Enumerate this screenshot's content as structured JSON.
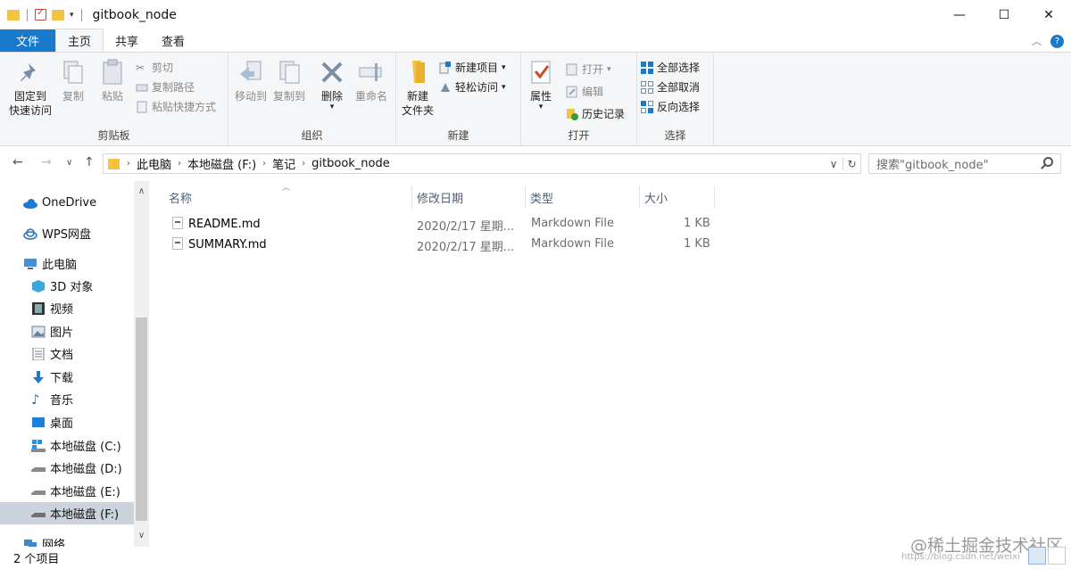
{
  "window": {
    "title": "gitbook_node"
  },
  "tabs": [
    {
      "label": "文件"
    },
    {
      "label": "主页"
    },
    {
      "label": "共享"
    },
    {
      "label": "查看"
    }
  ],
  "ribbon": {
    "clipboard": {
      "group_label": "剪贴板",
      "pin": "固定到",
      "pin2": "快速访问",
      "copy": "复制",
      "paste": "粘贴",
      "cut": "剪切",
      "copy_path": "复制路径",
      "paste_shortcut": "粘贴快捷方式"
    },
    "organize": {
      "group_label": "组织",
      "move_to": "移动到",
      "copy_to": "复制到",
      "delete": "删除",
      "rename": "重命名"
    },
    "new": {
      "group_label": "新建",
      "new_folder": "新建",
      "new_folder2": "文件夹",
      "new_item": "新建项目",
      "easy_access": "轻松访问"
    },
    "open": {
      "group_label": "打开",
      "properties": "属性",
      "open": "打开",
      "edit": "编辑",
      "history": "历史记录"
    },
    "select": {
      "group_label": "选择",
      "select_all": "全部选择",
      "select_none": "全部取消",
      "invert": "反向选择"
    }
  },
  "address": {
    "crumbs": [
      "此电脑",
      "本地磁盘 (F:)",
      "笔记",
      "gitbook_node"
    ]
  },
  "search": {
    "placeholder": "搜索\"gitbook_node\""
  },
  "nav": [
    {
      "label": "OneDrive"
    },
    {
      "label": "WPS网盘"
    },
    {
      "label": "此电脑"
    },
    {
      "label": "3D 对象"
    },
    {
      "label": "视频"
    },
    {
      "label": "图片"
    },
    {
      "label": "文档"
    },
    {
      "label": "下载"
    },
    {
      "label": "音乐"
    },
    {
      "label": "桌面"
    },
    {
      "label": "本地磁盘 (C:)"
    },
    {
      "label": "本地磁盘 (D:)"
    },
    {
      "label": "本地磁盘 (E:)"
    },
    {
      "label": "本地磁盘 (F:)"
    },
    {
      "label": "网络"
    }
  ],
  "columns": {
    "name": "名称",
    "modified": "修改日期",
    "type": "类型",
    "size": "大小"
  },
  "files": [
    {
      "name": "README.md",
      "modified": "2020/2/17 星期...",
      "type": "Markdown File",
      "size": "1 KB"
    },
    {
      "name": "SUMMARY.md",
      "modified": "2020/2/17 星期...",
      "type": "Markdown File",
      "size": "1 KB"
    }
  ],
  "status": {
    "count": "2 个项目"
  },
  "watermark": {
    "text": "@稀土掘金技术社区",
    "url": "https://blog.csdn.net/weixi"
  },
  "colors": {
    "accent": "#1979ca",
    "folder": "#f5c342",
    "selection": "#ccd3dc"
  }
}
